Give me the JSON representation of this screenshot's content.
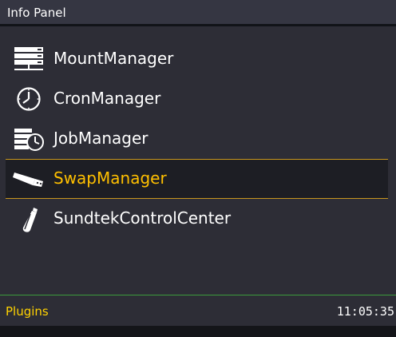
{
  "window": {
    "title": "Info Panel"
  },
  "menu": {
    "items": [
      {
        "label": "MountManager",
        "icon": "server-rack-icon",
        "selected": false
      },
      {
        "label": "CronManager",
        "icon": "clock-icon",
        "selected": false
      },
      {
        "label": "JobManager",
        "icon": "job-clock-icon",
        "selected": false
      },
      {
        "label": "SwapManager",
        "icon": "usb-stick-icon",
        "selected": true
      },
      {
        "label": "SundtekControlCenter",
        "icon": "tv-stick-icon",
        "selected": false
      }
    ]
  },
  "status": {
    "section": "Plugins",
    "time": "11:05:35"
  },
  "colors": {
    "background": "#2d2d36",
    "selected_text": "#ffc000",
    "selection_border": "#c8961e",
    "status_section": "#ffd200",
    "status_divider": "#3c9a3c"
  }
}
